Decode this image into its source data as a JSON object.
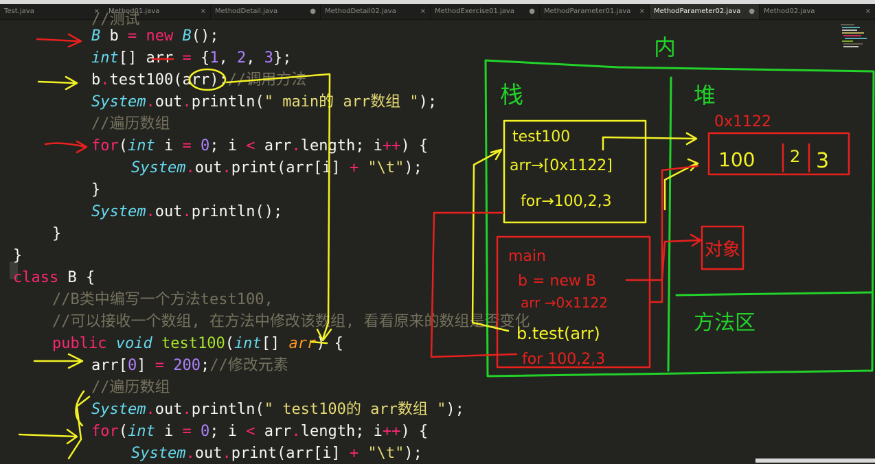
{
  "tabs": [
    {
      "label": "Test.java",
      "close": "×",
      "active": false
    },
    {
      "label": "Method01.java",
      "close": "×",
      "active": false
    },
    {
      "label": "MethodDetail.java",
      "close": "●",
      "active": false
    },
    {
      "label": "MethodDetail02.java",
      "close": "×",
      "active": false
    },
    {
      "label": "MethodExercise01.java",
      "close": "●",
      "active": false
    },
    {
      "label": "MethodParameter01.java",
      "close": "×",
      "active": false
    },
    {
      "label": "MethodParameter02.java",
      "close": "●",
      "active": true
    },
    {
      "label": "Method02.java",
      "close": "×",
      "active": false
    }
  ],
  "code": {
    "l0_comment": "//测试",
    "l1": [
      "B",
      " b ",
      "=",
      " new ",
      "B",
      "();"
    ],
    "l2": [
      "int",
      "[] arr ",
      "=",
      " {",
      "1",
      ", ",
      "2",
      ", ",
      "3",
      "};"
    ],
    "l3": [
      "b",
      ".",
      "test100(arr);",
      "//调用方法"
    ],
    "l4": [
      "System",
      ".",
      "out",
      ".",
      "println(",
      "\" main的 arr数组 \"",
      ");"
    ],
    "l5": "//遍历数组",
    "l6": [
      "for",
      "(",
      "int",
      " i ",
      "=",
      " ",
      "0",
      "; i ",
      "<",
      " arr",
      ".",
      "length; i",
      "++",
      ") {"
    ],
    "l7": [
      "System",
      ".",
      "out",
      ".",
      "print(arr[i] ",
      "+",
      " ",
      "\"\\t\"",
      ");"
    ],
    "l8": "}",
    "l9": [
      "System",
      ".",
      "out",
      ".",
      "println();"
    ],
    "l10": "}",
    "l11": "}",
    "l12": [
      "class",
      " B {"
    ],
    "l13": "//B类中编写一个方法test100,",
    "l14": "//可以接收一个数组, 在方法中修改该数组, 看看原来的数组是否变化",
    "l15": [
      "public",
      " ",
      "void",
      " ",
      "test100",
      "(",
      "int",
      "[] ",
      "arr",
      ") {"
    ],
    "l16": [
      "arr[",
      "0",
      "] ",
      "=",
      " ",
      "200",
      ";",
      "//修改元素"
    ],
    "l17": "//遍历数组",
    "l18": [
      "System",
      ".",
      "out",
      ".",
      "println(",
      "\" test100的 arr数组 \"",
      ");"
    ],
    "l19": [
      "for",
      "(",
      "int",
      " i ",
      "=",
      " ",
      "0",
      "; i ",
      "<",
      " arr",
      ".",
      "length; i",
      "++",
      ") {"
    ],
    "l20": [
      "System",
      ".",
      "out",
      ".",
      "print(arr[i] ",
      "+",
      " ",
      "\"\\t\"",
      ");"
    ]
  },
  "annotations": {
    "memory_title": "内",
    "stack_label": "栈",
    "heap_label": "堆",
    "heap_address": "0x1122",
    "heap_values": [
      "100",
      "2",
      "3"
    ],
    "test100_frame": [
      "test100",
      "arr→[0x1122]",
      "for→100,2,3"
    ],
    "main_frame": [
      "main",
      "b = new B",
      "arr →0x1122",
      "b.test(arr)",
      "for 100,2,3"
    ],
    "object_label": "对象",
    "method_area_label": "方法区"
  },
  "colors": {
    "red_ink": "#e8201e",
    "yellow_ink": "#f4f224",
    "green_ink": "#22d22a",
    "editor_bg": "#23241f"
  }
}
